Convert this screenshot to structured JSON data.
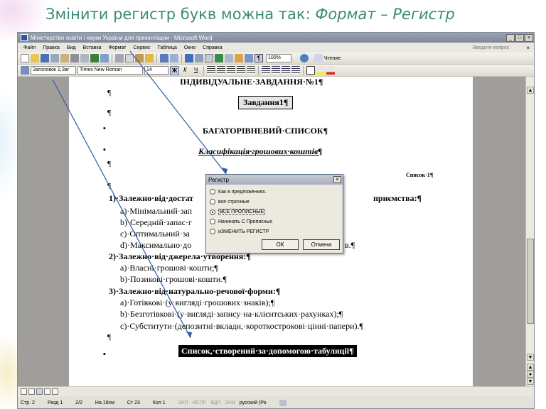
{
  "slide_title": {
    "prefix": "Змінити регистр букв можна так: ",
    "path": "Формат – Регистр"
  },
  "window": {
    "title": "Міністерство освіти і науки України для презентации - Microsoft Word",
    "controls": [
      "_",
      "□",
      "×"
    ]
  },
  "menu": {
    "items": [
      "Файл",
      "Правка",
      "Вид",
      "Вставка",
      "Формат",
      "Сервис",
      "Таблица",
      "Окно",
      "Справка"
    ],
    "ask_placeholder": "Введите вопрос",
    "close": "×"
  },
  "toolbar": {
    "zoom": "100%",
    "reading": "Чтение"
  },
  "format_toolbar": {
    "style": "Заголовок 1;Заг",
    "font": "Times New Roman",
    "size": "14",
    "bold": "Ж",
    "italic": "К",
    "underline": "Ч"
  },
  "document": {
    "heading": "ІНДИВІДУАЛЬНЕ·ЗАВДАННЯ·№1¶",
    "task_box": "Завдання1¶",
    "multilevel_title": "БАГАТОРІВНЕВИЙ·СПИСОК¶",
    "classification": "Класифікація·грошових·коштів¶",
    "list_ref": "Список·1¶",
    "pilcrow": "¶",
    "bullet": "▪",
    "item1_start": "1)·Залежно·від·достат",
    "item1_end": "приємства:¶",
    "item1a": "a)·Мінімальний·зап",
    "item1b": "b)·Середній·запас·г",
    "item1c": "c)·Оптимальний·за",
    "item1d": "d)·Максимально·до",
    "item1d_end": "в.¶",
    "item2": "2)·Залежно·від·джерела·утворення:¶",
    "item2a": "a)·Власні·грошові·кошти;¶",
    "item2b": "b)·Позикові·грошові·кошти.¶",
    "item3": "3)·Залежно·від·натурально-речової·форми:¶",
    "item3a": "a)·Готівкові·(у·вигляді·грошових·знаків);¶",
    "item3b": "b)·Безготівкові·(у·вигляді·запису·на·клієнтських·рахунках);¶",
    "item3c": "c)·Субститути·(депозитні·вклади,·короткострокові·цінні·папери).¶",
    "tab_list": "Список,·створений·за·допомогою·табуляції¶"
  },
  "dialog": {
    "title": "Регистр",
    "close": "×",
    "options": [
      {
        "label": "Как в предложениях.",
        "selected": false
      },
      {
        "label": "все строчные",
        "selected": false
      },
      {
        "label": "ВСЕ ПРОПИСНЫЕ",
        "selected": true
      },
      {
        "label": "Начинать С Прописных",
        "selected": false
      },
      {
        "label": "иЗМЕНИТЬ РЕГИСТР",
        "selected": false
      }
    ],
    "ok": "ОК",
    "cancel": "Отмена"
  },
  "statusbar": {
    "page": "Стр. 2",
    "section": "Разд 1",
    "pages": "2/2",
    "at": "На 18см",
    "line": "Ст 23",
    "col": "Кол 1",
    "rec": "ЗАП",
    "trk": "ИСПР",
    "ext": "ВДЛ",
    "ovr": "ЗАМ",
    "lang": "русский (Ро"
  },
  "colors": {
    "title_text": "#3c8a7a",
    "pointer_line": "#2e5fa8"
  }
}
